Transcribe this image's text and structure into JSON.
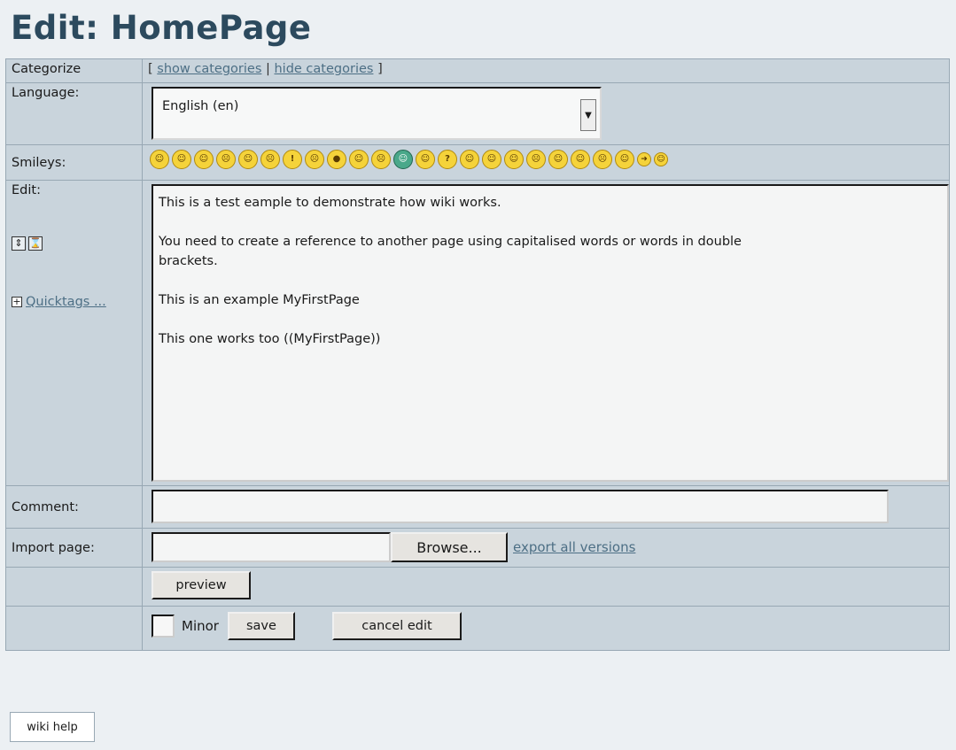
{
  "page": {
    "title": "Edit: HomePage"
  },
  "categorize": {
    "label": "Categorize",
    "open_bracket": "[",
    "show": "show categories",
    "sep": "|",
    "hide": "hide categories",
    "close_bracket": "]"
  },
  "language": {
    "label": "Language:",
    "value": "English (en)"
  },
  "smileys": {
    "label": "Smileys:",
    "items": [
      "biggrin",
      "confused",
      "cool",
      "cry",
      "eek",
      "evil",
      "exclaim",
      "frown",
      "idea",
      "lol",
      "mad",
      "mrgreen",
      "neutral",
      "question",
      "razz",
      "redface",
      "rolleyes",
      "sad",
      "smile",
      "surprised",
      "twisted",
      "wink",
      "arrow",
      "santa"
    ]
  },
  "edit": {
    "label": "Edit:",
    "quicktags": "Quicktags ...",
    "content": "This is a test eample to demonstrate how wiki works.\n\nYou need to create a reference to another page using capitalised words or words in double\nbrackets.\n\nThis is an example MyFirstPage\n\nThis one works too ((MyFirstPage))"
  },
  "comment": {
    "label": "Comment:",
    "value": ""
  },
  "import": {
    "label": "Import page:",
    "browse": "Browse...",
    "export_link": "export all versions"
  },
  "actions": {
    "preview": "preview",
    "minor": "Minor",
    "save": "save",
    "cancel": "cancel edit"
  },
  "footer": {
    "wiki_help": "wiki help"
  }
}
